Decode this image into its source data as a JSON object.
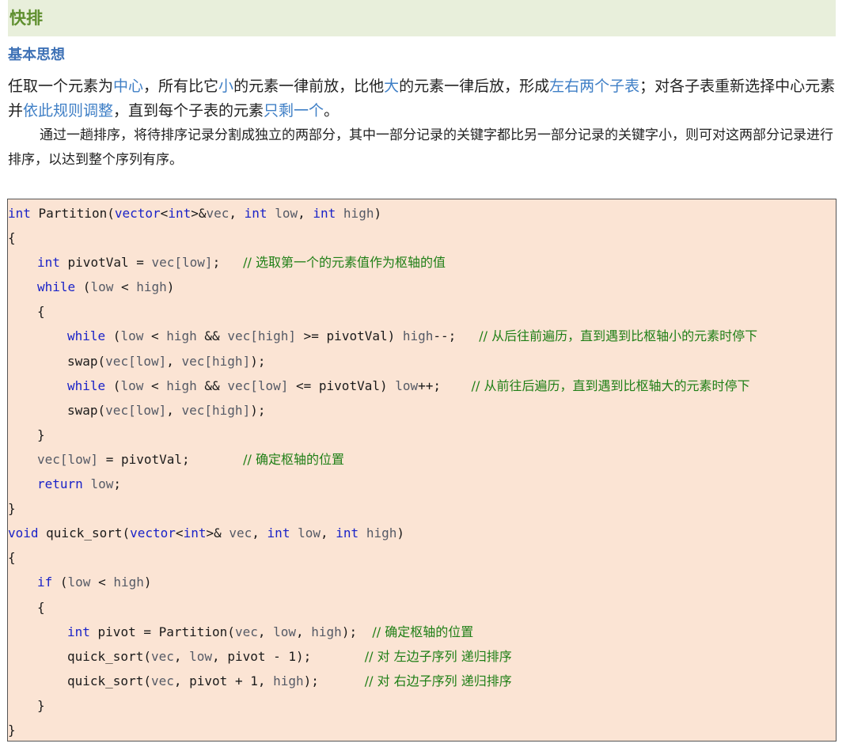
{
  "heading": "快排",
  "subheading": "基本思想",
  "paragraph1": {
    "t1": "任取一个元素为",
    "h1": "中心",
    "t2": "，所有比它",
    "h2": "小",
    "t3": "的元素一律前放，比他",
    "h3": "大",
    "t4": "的元素一律后放，形成",
    "h4": "左右两个子表",
    "t5": "；对各子表重新选择中心元素并",
    "h5": "依此规则调整",
    "t6": "，直到每个子表的元素",
    "h6": "只剩一个",
    "t7": "。"
  },
  "paragraph2": "通过一趟排序，将待排序记录分割成独立的两部分，其中一部分记录的关键字都比另一部分记录的关键字小，则可对这两部分记录进行排序，以达到整个序列有序。",
  "code": {
    "l1": {
      "a": "int",
      "b": " Partition(",
      "c": "vector",
      "d": "<",
      "e": "int",
      "f": ">&",
      "g": "vec",
      "h": ", ",
      "i": "int",
      "j": " ",
      "k": "low",
      "l": ", ",
      "m": "int",
      "n": " ",
      "o": "high",
      "p": ")"
    },
    "l2": "{",
    "l3": {
      "a": "int",
      "b": " pivotVal = ",
      "c": "vec[low]",
      "d": ";   ",
      "e": "// 选取第一个的元素值作为枢轴的值"
    },
    "l4": {
      "a": "while",
      "b": " (",
      "c": "low",
      "d": " < ",
      "e": "high",
      "f": ")"
    },
    "l5": "{",
    "l6": {
      "a": "while",
      "b": " (",
      "c": "low",
      "d": " < ",
      "e": "high",
      "f": " && ",
      "g": "vec[high]",
      "h": " >= pivotVal) ",
      "i": "high",
      "j": "--;   ",
      "k": "// 从后往前遍历，直到遇到比枢轴小的元素时停下"
    },
    "l7": {
      "a": "swap(",
      "b": "vec[low]",
      "c": ", ",
      "d": "vec[high]",
      "e": ");"
    },
    "l8": {
      "a": "while",
      "b": " (",
      "c": "low",
      "d": " < ",
      "e": "high",
      "f": " && ",
      "g": "vec[low]",
      "h": " <= pivotVal) ",
      "i": "low",
      "j": "++;    ",
      "k": "// 从前往后遍历，直到遇到比枢轴大的元素时停下"
    },
    "l9": {
      "a": "swap(",
      "b": "vec[low]",
      "c": ", ",
      "d": "vec[high]",
      "e": ");"
    },
    "l10": "}",
    "l11": {
      "a": "vec[low]",
      "b": " = pivotVal;       ",
      "c": "// 确定枢轴的位置"
    },
    "l12": {
      "a": "return",
      "b": " ",
      "c": "low",
      "d": ";"
    },
    "l13": "}",
    "l14": {
      "a": "void",
      "b": " quick_sort(",
      "c": "vector",
      "d": "<",
      "e": "int",
      "f": ">& ",
      "g": "vec",
      "h": ", ",
      "i": "int",
      "j": " ",
      "k": "low",
      "l": ", ",
      "m": "int",
      "n": " ",
      "o": "high",
      "p": ")"
    },
    "l15": "{",
    "l16": {
      "a": "if",
      "b": " (",
      "c": "low",
      "d": " < ",
      "e": "high",
      "f": ")"
    },
    "l17": "{",
    "l18": {
      "a": "int",
      "b": " pivot = Partition(",
      "c": "vec",
      "d": ", ",
      "e": "low",
      "f": ", ",
      "g": "high",
      "h": ");  ",
      "i": "// 确定枢轴的位置"
    },
    "l19": {
      "a": "quick_sort(",
      "b": "vec",
      "c": ", ",
      "d": "low",
      "e": ", pivot - 1);       ",
      "f": "// 对 左边子序列 递归排序"
    },
    "l20": {
      "a": "quick_sort(",
      "b": "vec",
      "c": ", pivot + 1, ",
      "d": "high",
      "e": ");      ",
      "f": "// 对 右边子序列 递归排序"
    },
    "l21": "}",
    "l22": "}"
  },
  "colors": {
    "heading_bg": "#e8efdb",
    "heading_text": "#5f8f2f",
    "subheading_text": "#3f72b6",
    "highlight_text": "#3f7fc6",
    "code_bg": "#fbe4d4",
    "keyword": "#1a23c8",
    "comment": "#1f7f16",
    "identifier": "#555a66"
  }
}
